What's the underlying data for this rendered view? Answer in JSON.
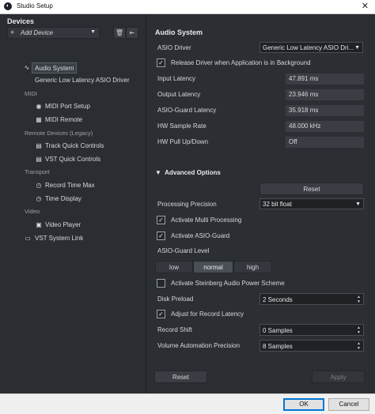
{
  "window": {
    "title": "Studio Setup",
    "close_glyph": "✕"
  },
  "devices": {
    "title": "Devices",
    "add_device": "Add Device",
    "items": {
      "audio_system": "Audio System",
      "asio_driver": "Generic Low Latency ASIO Driver",
      "midi_group": "MIDI",
      "midi_port_setup": "MIDI Port Setup",
      "midi_remote": "MIDI Remote",
      "remote_group": "Remote Devices (Legacy)",
      "track_quick_controls": "Track Quick Controls",
      "vst_quick_controls": "VST Quick Controls",
      "transport_group": "Transport",
      "record_time_max": "Record Time Max",
      "time_display": "Time Display",
      "video_group": "Video",
      "video_player": "Video Player",
      "vst_system_link": "VST System Link"
    }
  },
  "audio_system": {
    "title": "Audio System",
    "asio_driver_label": "ASIO Driver",
    "asio_driver_value": "Generic Low Latency ASIO Dri...",
    "release_driver_label": "Release Driver when Application is in Background",
    "release_driver_checked": true,
    "input_latency_label": "Input Latency",
    "input_latency": "47.891 ms",
    "output_latency_label": "Output Latency",
    "output_latency": "23.946 ms",
    "asio_guard_latency_label": "ASIO-Guard Latency",
    "asio_guard_latency": "35.918 ms",
    "sample_rate_label": "HW Sample Rate",
    "sample_rate": "48.000 kHz",
    "pull_label": "HW Pull Up/Down",
    "pull": "Off"
  },
  "advanced": {
    "title": "Advanced Options",
    "reset_top": "Reset",
    "precision_label": "Processing Precision",
    "precision_value": "32 bit float",
    "multi_processing_label": "Activate Multi Processing",
    "multi_processing_checked": true,
    "asio_guard_label": "Activate ASIO-Guard",
    "asio_guard_checked": true,
    "asio_guard_level_label": "ASIO-Guard Level",
    "levels": [
      "low",
      "normal",
      "high"
    ],
    "selected_level": "normal",
    "power_scheme_label": "Activate Steinberg Audio Power Scheme",
    "power_scheme_checked": false,
    "disk_preload_label": "Disk Preload",
    "disk_preload_value": "2 Seconds",
    "adjust_latency_label": "Adjust for Record Latency",
    "adjust_latency_checked": true,
    "record_shift_label": "Record Shift",
    "record_shift_value": "0 Samples",
    "vol_precision_label": "Volume Automation Precision",
    "vol_precision_value": "8 Samples",
    "reset_bottom": "Reset",
    "apply": "Apply"
  },
  "dialog": {
    "ok": "OK",
    "cancel": "Cancel"
  }
}
